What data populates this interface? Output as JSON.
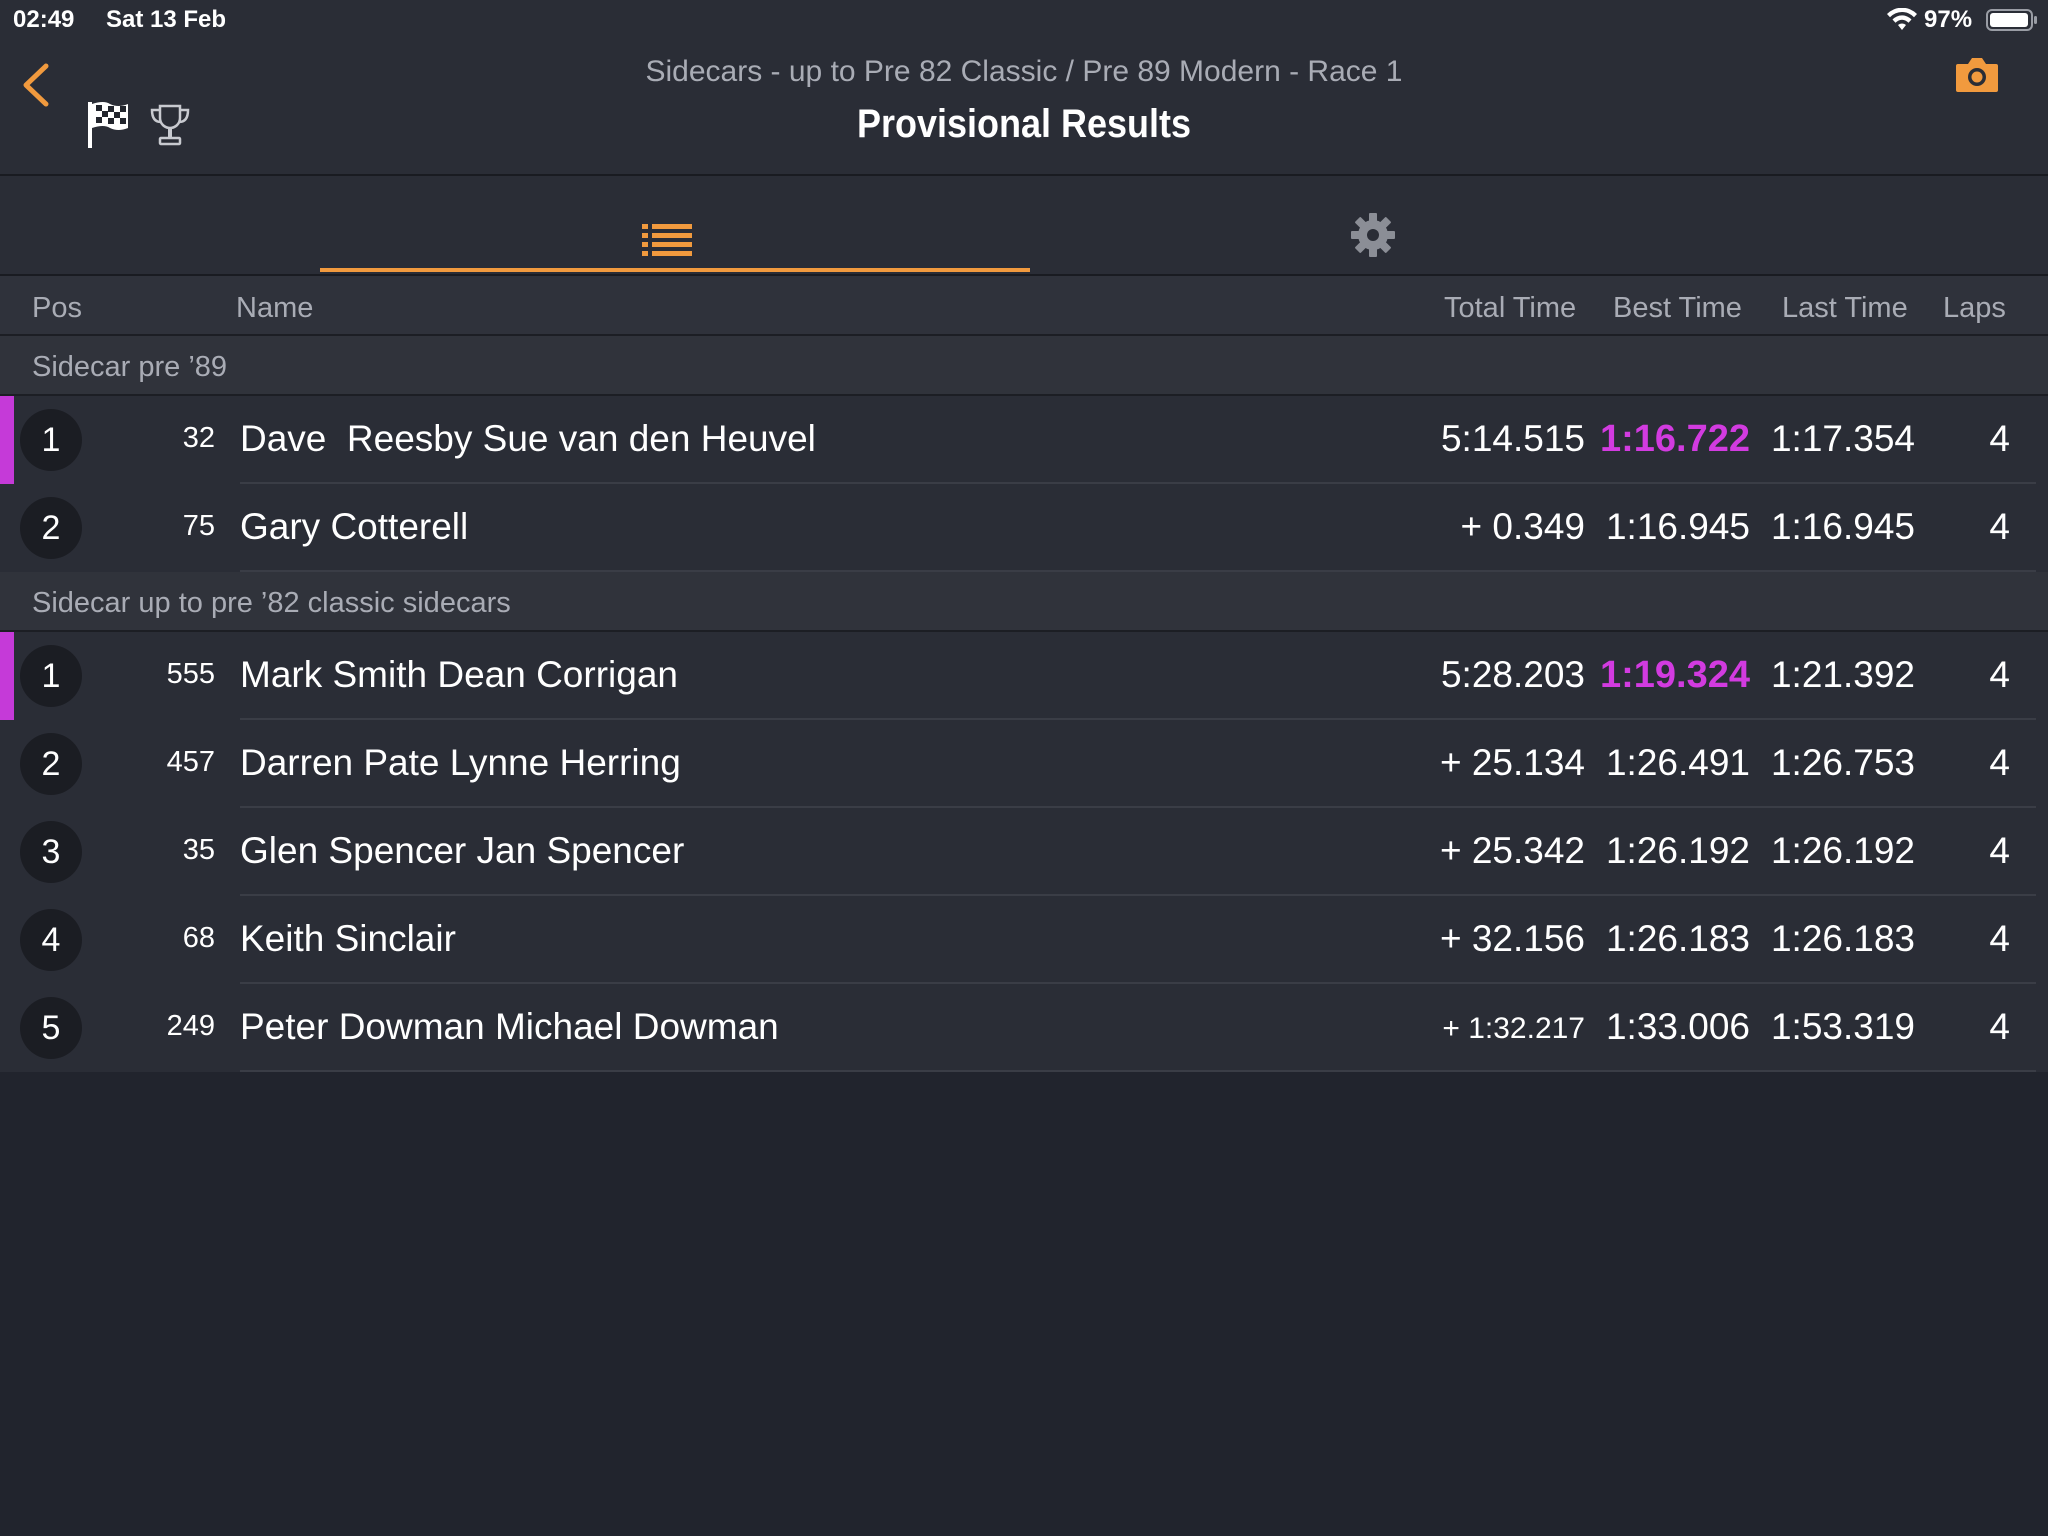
{
  "status_bar": {
    "time": "02:49",
    "date": "Sat 13 Feb",
    "battery_pct": "97%"
  },
  "header": {
    "subtitle": "Sidecars - up to Pre 82 Classic / Pre 89 Modern - Race 1",
    "title": "Provisional Results",
    "icons": [
      "back-icon",
      "checkered-flag-icon",
      "trophy-icon",
      "camera-icon"
    ]
  },
  "tabs": {
    "icons": [
      "list-icon",
      "gear-icon"
    ],
    "selected": "list",
    "accent_color": "#f19a3e"
  },
  "columns": {
    "pos": "Pos",
    "name": "Name",
    "total": "Total Time",
    "best": "Best Time",
    "last": "Last Time",
    "laps": "Laps"
  },
  "colors": {
    "fastest": "#d23be0",
    "accent": "#f19a3e"
  },
  "groups": [
    {
      "title": "Sidecar pre ’89",
      "rows": [
        {
          "pos": "1",
          "num": "32",
          "name": "Dave  Reesby Sue van den Heuvel",
          "total": "5:14.515",
          "best": "1:16.722",
          "last": "1:17.354",
          "laps": "4",
          "fastest": true
        },
        {
          "pos": "2",
          "num": "75",
          "name": "Gary Cotterell",
          "total": "+ 0.349",
          "best": "1:16.945",
          "last": "1:16.945",
          "laps": "4",
          "fastest": false
        }
      ]
    },
    {
      "title": "Sidecar up to pre ’82 classic sidecars",
      "rows": [
        {
          "pos": "1",
          "num": "555",
          "name": "Mark Smith Dean Corrigan",
          "total": "5:28.203",
          "best": "1:19.324",
          "last": "1:21.392",
          "laps": "4",
          "fastest": true
        },
        {
          "pos": "2",
          "num": "457",
          "name": "Darren Pate Lynne Herring",
          "total": "+ 25.134",
          "best": "1:26.491",
          "last": "1:26.753",
          "laps": "4",
          "fastest": false
        },
        {
          "pos": "3",
          "num": "35",
          "name": "Glen Spencer Jan Spencer",
          "total": "+ 25.342",
          "best": "1:26.192",
          "last": "1:26.192",
          "laps": "4",
          "fastest": false
        },
        {
          "pos": "4",
          "num": "68",
          "name": "Keith Sinclair",
          "total": "+ 32.156",
          "best": "1:26.183",
          "last": "1:26.183",
          "laps": "4",
          "fastest": false
        },
        {
          "pos": "5",
          "num": "249",
          "name": "Peter Dowman Michael Dowman",
          "total": "+ 1:32.217",
          "best": "1:33.006",
          "last": "1:53.319",
          "laps": "4",
          "fastest": false
        }
      ]
    }
  ]
}
